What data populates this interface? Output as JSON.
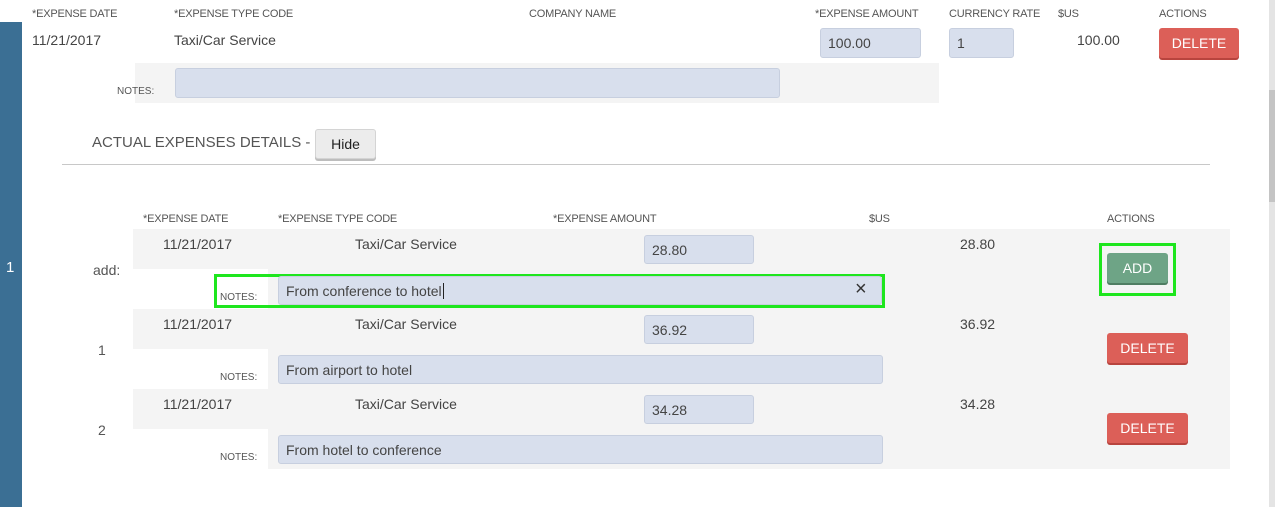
{
  "sidebar": {
    "row_number": "1"
  },
  "expense": {
    "headers": {
      "date": "*EXPENSE DATE",
      "type_code": "*EXPENSE TYPE CODE",
      "company": "COMPANY NAME",
      "amount": "*EXPENSE AMOUNT",
      "currency_rate": "CURRENCY RATE",
      "usd": "$US",
      "actions": "ACTIONS"
    },
    "date": "11/21/2017",
    "type_code": "Taxi/Car Service",
    "company": "",
    "amount": "100.00",
    "currency_rate": "1",
    "usd": "100.00",
    "delete_label": "DELETE",
    "notes_label": "NOTES:",
    "notes_value": ""
  },
  "details": {
    "title": "ACTUAL EXPENSES DETAILS - - 1",
    "hide_label": "Hide",
    "headers": {
      "date": "*EXPENSE DATE",
      "type_code": "*EXPENSE TYPE CODE",
      "amount": "*EXPENSE AMOUNT",
      "usd": "$US",
      "actions": "ACTIONS"
    },
    "add_row": {
      "label": "add:",
      "date": "11/21/2017",
      "type_code": "Taxi/Car Service",
      "amount": "28.80",
      "usd": "28.80",
      "notes_label": "NOTES:",
      "notes": "From conference to hotel",
      "clear_icon": "×",
      "add_label": "ADD"
    },
    "rows": [
      {
        "index": "1",
        "date": "11/21/2017",
        "type_code": "Taxi/Car Service",
        "amount": "36.92",
        "usd": "36.92",
        "notes_label": "NOTES:",
        "notes": "From airport to hotel",
        "delete_label": "DELETE"
      },
      {
        "index": "2",
        "date": "11/21/2017",
        "type_code": "Taxi/Car Service",
        "amount": "34.28",
        "usd": "34.28",
        "notes_label": "NOTES:",
        "notes": "From hotel to conference",
        "delete_label": "DELETE"
      }
    ]
  },
  "colors": {
    "sidebar": "#3b6f94",
    "delete": "#dc5f58",
    "add": "#6ea486",
    "input": "#d8dfed",
    "highlight": "#1ee61e"
  }
}
